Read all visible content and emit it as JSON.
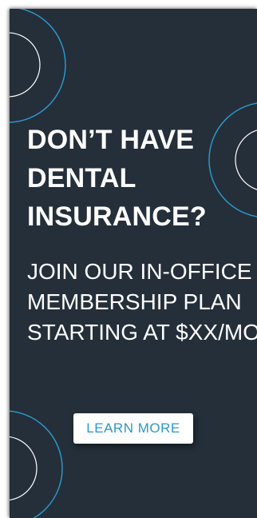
{
  "ad": {
    "headline": "DON’T HAVE\nDENTAL\nINSURANCE?",
    "subhead": "JOIN OUR IN-OFFICE\nMEMBERSHIP PLAN\nSTARTING AT $XX/MO. -",
    "cta_label": "LEARN MORE"
  },
  "colors": {
    "background": "#242f3a",
    "accent": "#2c96c9",
    "text": "#ffffff",
    "button": "#ffffff"
  }
}
